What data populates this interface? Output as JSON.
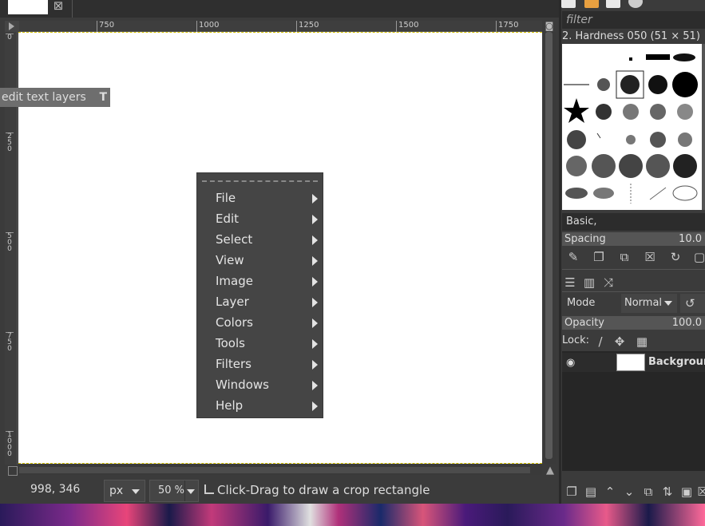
{
  "tab": {
    "close_glyph": "⊠"
  },
  "rulers": {
    "horizontal": [
      "750",
      "1000",
      "1250",
      "1500",
      "1750"
    ],
    "vertical": [
      "0",
      "2\n5\n0",
      "5\n0\n0",
      "7\n5\n0",
      "1\n0\n0\n0"
    ]
  },
  "tooltip": {
    "text": "edit text layers",
    "badge": "T"
  },
  "context_menu": {
    "items": [
      "File",
      "Edit",
      "Select",
      "View",
      "Image",
      "Layer",
      "Colors",
      "Tools",
      "Filters",
      "Windows",
      "Help"
    ]
  },
  "statusbar": {
    "coords": "998, 346",
    "unit": "px",
    "zoom": "50 %",
    "message": "Click-Drag to draw a crop rectangle"
  },
  "brushes": {
    "filter_placeholder": "filter",
    "selected_name": "2. Hardness 050 (51 × 51)",
    "preset": "Basic,",
    "spacing_label": "Spacing",
    "spacing_value": "10.0"
  },
  "layers": {
    "mode_label": "Mode",
    "mode_value": "Normal",
    "opacity_label": "Opacity",
    "opacity_value": "100.0",
    "lock_label": "Lock:",
    "layer_name": "Background"
  },
  "colors": {
    "accent": "#d7c300",
    "menu_bg": "#454545",
    "panel_bg": "#3b3b3b"
  }
}
